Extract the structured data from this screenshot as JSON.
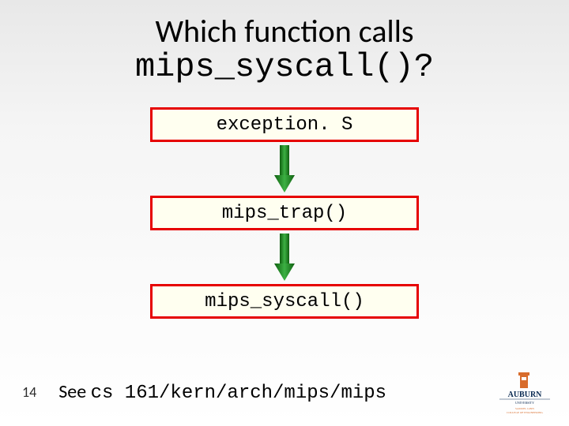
{
  "title": {
    "line1": "Which function calls",
    "line2": "mips_syscall()?"
  },
  "boxes": [
    {
      "label": "exception. S"
    },
    {
      "label": "mips_trap()"
    },
    {
      "label": "mips_syscall()"
    }
  ],
  "arrow_color": "#228b22",
  "box_fill": "#fffff0",
  "box_border": "#e60000",
  "footer": {
    "slide_number": "14",
    "see_prefix": "See ",
    "see_path": "cs 161/kern/arch/mips/mips"
  },
  "logo": {
    "name": "AUBURN",
    "subtitle1": "UNIVERSITY",
    "subtitle2": "SAMUEL GINN",
    "subtitle3": "COLLEGE OF ENGINEERING"
  }
}
